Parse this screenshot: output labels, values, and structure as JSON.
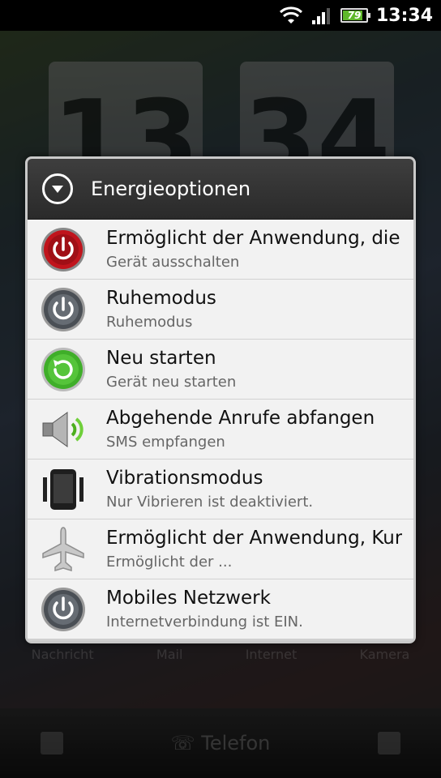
{
  "status_bar": {
    "battery_level": "79",
    "time": "13:34"
  },
  "home_screen": {
    "clock_hours": "13",
    "clock_minutes": "34",
    "dock": [
      "Nachricht",
      "Mail",
      "Internet",
      "Kamera"
    ],
    "bottom_phone_label": "Telefon"
  },
  "dialog": {
    "title": "Energieoptionen",
    "items": [
      {
        "title": "Ermöglicht der Anwendung, die",
        "subtitle": "Gerät ausschalten",
        "icon": "power-off-red-icon"
      },
      {
        "title": "Ruhemodus",
        "subtitle": "Ruhemodus",
        "icon": "power-grey-icon"
      },
      {
        "title": "Neu starten",
        "subtitle": "Gerät neu starten",
        "icon": "restart-green-icon"
      },
      {
        "title": "Abgehende Anrufe abfangen",
        "subtitle": "SMS empfangen",
        "icon": "speaker-icon"
      },
      {
        "title": "Vibrationsmodus",
        "subtitle": "Nur Vibrieren ist deaktiviert.",
        "icon": "vibrate-phone-icon"
      },
      {
        "title": "Ermöglicht der Anwendung, Kur",
        "subtitle": "Ermöglicht der ...",
        "icon": "airplane-icon"
      },
      {
        "title": "Mobiles Netzwerk",
        "subtitle": "Internetverbindung ist EIN.",
        "icon": "power-grey-icon"
      }
    ]
  },
  "colors": {
    "header_bg": "#333333",
    "list_bg": "#f2f2f2",
    "power_red": "#c0141c",
    "restart_green": "#3fae29",
    "battery_green": "#5fb82a"
  }
}
